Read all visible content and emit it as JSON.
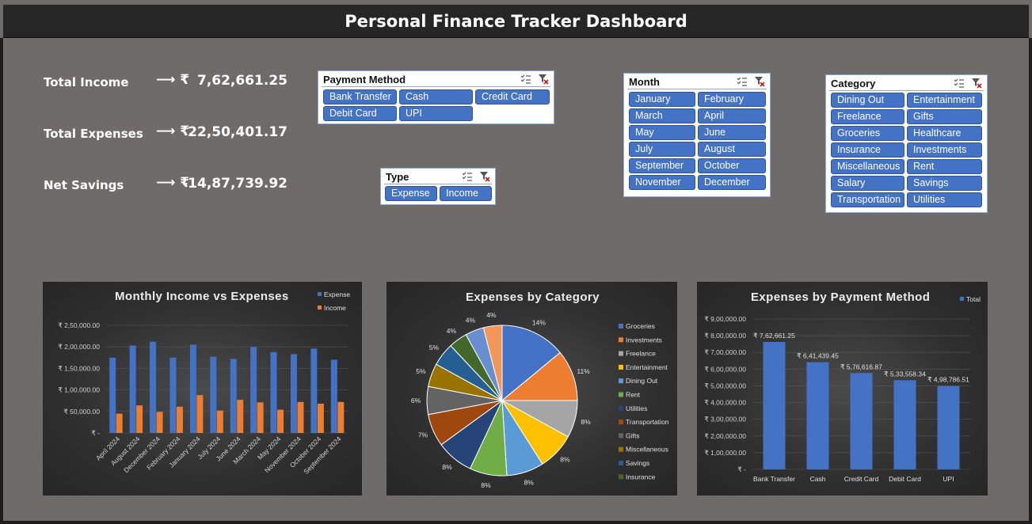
{
  "title": "Personal Finance Tracker Dashboard",
  "kpis": [
    {
      "label": "Total Income",
      "arrow": "⟶ ₹",
      "value": "7,62,661.25"
    },
    {
      "label": "Total Expenses",
      "arrow": "⟶ ₹",
      "value": "22,50,401.17"
    },
    {
      "label": "Net Savings",
      "arrow": "⟶ ₹",
      "value": "-14,87,739.92"
    }
  ],
  "slicers": {
    "payment": {
      "title": "Payment Method",
      "items": [
        "Bank Transfer",
        "Cash",
        "Credit Card",
        "Debit Card",
        "UPI"
      ]
    },
    "type": {
      "title": "Type",
      "items": [
        "Expense",
        "Income"
      ]
    },
    "month": {
      "title": "Month",
      "items": [
        "January",
        "February",
        "March",
        "April",
        "May",
        "June",
        "July",
        "August",
        "September",
        "October",
        "November",
        "December"
      ]
    },
    "category": {
      "title": "Category",
      "items": [
        "Dining Out",
        "Entertainment",
        "Freelance",
        "Gifts",
        "Groceries",
        "Healthcare",
        "Insurance",
        "Investments",
        "Miscellaneous",
        "Rent",
        "Salary",
        "Savings",
        "Transportation",
        "Utilities"
      ]
    }
  },
  "colors": {
    "accent": "#4472c4",
    "income": "#ed7d31",
    "background": "#6f6b69"
  },
  "chart_data": [
    {
      "type": "bar",
      "title": "Monthly Income vs Expenses",
      "categories": [
        "April 2024",
        "August 2024",
        "December 2024",
        "February 2024",
        "January 2024",
        "July 2024",
        "June 2024",
        "March 2024",
        "May 2024",
        "November 2024",
        "October 2024",
        "September 2024"
      ],
      "series": [
        {
          "name": "Expense",
          "color": "#4472c4",
          "values": [
            175000,
            203000,
            212000,
            175000,
            205000,
            177000,
            172000,
            200000,
            188000,
            183000,
            196000,
            170000
          ]
        },
        {
          "name": "Income",
          "color": "#ed7d31",
          "values": [
            45000,
            64000,
            49000,
            61000,
            88000,
            52000,
            77000,
            71000,
            54000,
            72000,
            68000,
            72000
          ]
        }
      ],
      "ylim": [
        0,
        250000
      ],
      "yticks": [
        0,
        50000,
        100000,
        150000,
        200000,
        250000
      ],
      "ytick_labels": [
        "₹ -",
        "₹ 50,000.00",
        "₹ 1,00,000.00",
        "₹ 1,50,000.00",
        "₹ 2,00,000.00",
        "₹ 2,50,000.00"
      ],
      "legend": "top-right",
      "grid": true
    },
    {
      "type": "pie",
      "title": "Expenses by Category",
      "slices": [
        {
          "label": "Groceries",
          "value": 14,
          "text": "14%",
          "color": "#4472c4"
        },
        {
          "label": "Investments",
          "value": 11,
          "text": "11%",
          "color": "#ed7d31"
        },
        {
          "label": "Freelance",
          "value": 8,
          "text": "8%",
          "color": "#a5a5a5"
        },
        {
          "label": "Entertainment",
          "value": 8,
          "text": "8%",
          "color": "#ffc000"
        },
        {
          "label": "Dining Out",
          "value": 8,
          "text": "8%",
          "color": "#5b9bd5"
        },
        {
          "label": "Rent",
          "value": 8,
          "text": "8%",
          "color": "#70ad47"
        },
        {
          "label": "Utilities",
          "value": 8,
          "text": "8%",
          "color": "#264478"
        },
        {
          "label": "Transportation",
          "value": 7,
          "text": "7%",
          "color": "#9e480e"
        },
        {
          "label": "Gifts",
          "value": 6,
          "text": "6%",
          "color": "#636363"
        },
        {
          "label": "Miscellaneous",
          "value": 5,
          "text": "5%",
          "color": "#997300"
        },
        {
          "label": "Savings",
          "value": 5,
          "text": "5%",
          "color": "#255e91"
        },
        {
          "label": "Insurance",
          "value": 4,
          "text": "4%",
          "color": "#43682b"
        },
        {
          "label": "Healthcare",
          "value": 4,
          "text": "4%",
          "color": "#698ed0"
        },
        {
          "label": "Salary",
          "value": 4,
          "text": "4%",
          "color": "#f1975a"
        }
      ],
      "legend_items": [
        "Groceries",
        "Investments",
        "Freelance",
        "Entertainment",
        "Dining Out",
        "Rent",
        "Utilities",
        "Transportation",
        "Gifts",
        "Miscellaneous",
        "Savings",
        "Insurance"
      ],
      "legend": "right"
    },
    {
      "type": "bar",
      "title": "Expenses by Payment Method",
      "categories": [
        "Bank Transfer",
        "Cash",
        "Credit Card",
        "Debit Card",
        "UPI"
      ],
      "series": [
        {
          "name": "Total",
          "color": "#4472c4",
          "values": [
            762661.25,
            641439.45,
            576616.87,
            533558.34,
            498786.51
          ]
        }
      ],
      "data_labels": [
        "₹ 7,62,661.25",
        "₹ 6,41,439.45",
        "₹ 5,76,616.87",
        "₹ 5,33,558.34",
        "₹ 4,98,786.51"
      ],
      "ylim": [
        0,
        900000
      ],
      "yticks": [
        0,
        100000,
        200000,
        300000,
        400000,
        500000,
        600000,
        700000,
        800000,
        900000
      ],
      "ytick_labels": [
        "₹ -",
        "₹ 1,00,000.00",
        "₹ 2,00,000.00",
        "₹ 3,00,000.00",
        "₹ 4,00,000.00",
        "₹ 5,00,000.00",
        "₹ 6,00,000.00",
        "₹ 7,00,000.00",
        "₹ 8,00,000.00",
        "₹ 9,00,000.00"
      ],
      "legend": "top-right",
      "grid": true
    }
  ]
}
